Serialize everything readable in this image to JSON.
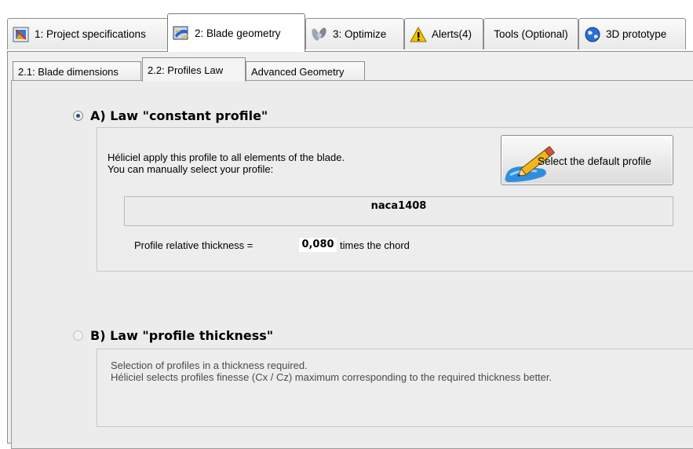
{
  "top_tabs": [
    {
      "label": "1: Project specifications",
      "icon": "project-icon"
    },
    {
      "label": "2: Blade geometry",
      "icon": "blade-icon"
    },
    {
      "label": "3: Optimize",
      "icon": "optimize-icon"
    },
    {
      "label": "Alerts(4)",
      "icon": "warning-icon"
    },
    {
      "label": "Tools (Optional)",
      "icon": ""
    },
    {
      "label": "3D prototype",
      "icon": "globe-icon"
    }
  ],
  "sub_tabs": [
    {
      "label": "2.1: Blade dimensions"
    },
    {
      "label": "2.2: Profiles Law"
    },
    {
      "label": "Advanced Geometry"
    }
  ],
  "section_a": {
    "title": "A) Law \"constant profile\"",
    "selected": true,
    "description_line1": "Héliciel apply this profile to all elements of the blade.",
    "description_line2": "You can manually select your profile:",
    "default_button_label": "Select the default profile",
    "profile_name": "naca1408",
    "thickness_label": "Profile relative thickness =",
    "thickness_value": "0,080",
    "thickness_unit": "times the chord"
  },
  "section_b": {
    "title": "B) Law  \"profile thickness\"",
    "selected": false,
    "description_line1": "Selection of profiles in a thickness required.",
    "description_line2": "Héliciel selects profiles finesse (Cx / Cz) maximum corresponding to the required thickness better."
  },
  "colors": {
    "panel_bg": "#ececec",
    "border": "#8c8c8c",
    "radio_dot": "#2d4f86",
    "accent_blue": "#2a6fd6",
    "warning_yellow": "#f2c200"
  }
}
